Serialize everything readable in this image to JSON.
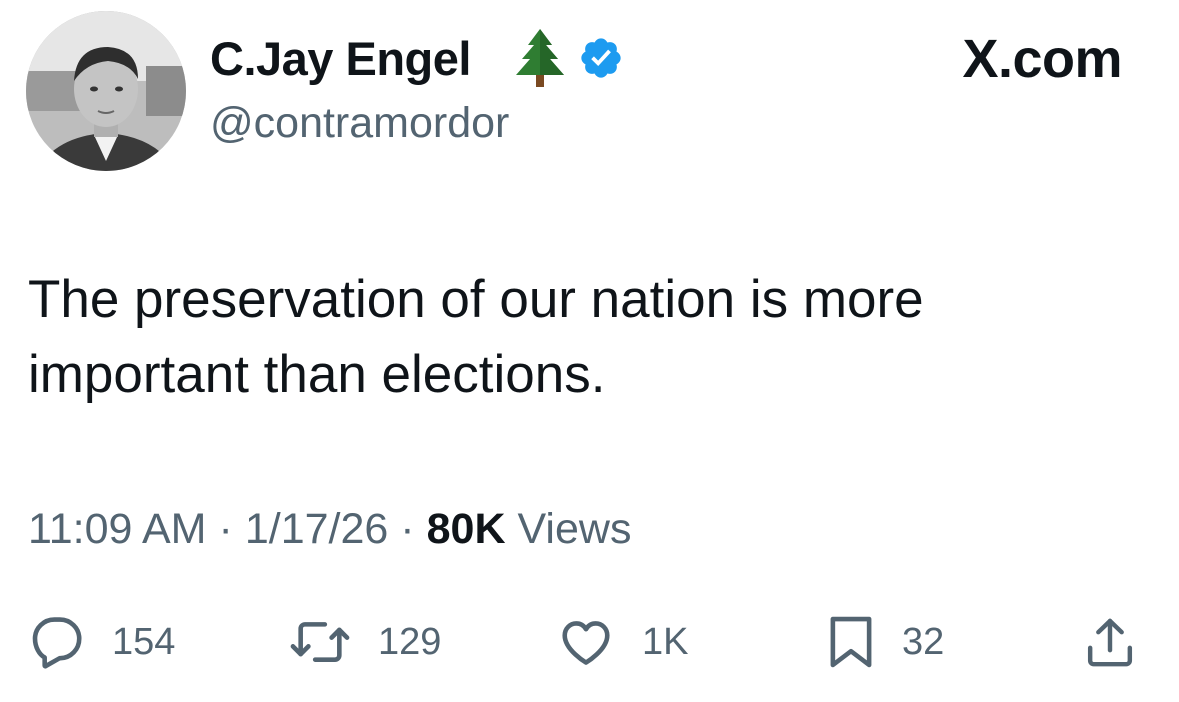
{
  "author": {
    "display_name": "C.Jay Engel",
    "name_emoji_icon": "evergreen-tree-icon",
    "verified_icon": "verified-badge-icon",
    "verified_color": "#1d9bf0",
    "handle": "@contramordor"
  },
  "brand": "X.com",
  "tweet": {
    "text": "The preservation of our nation is more important than elections."
  },
  "meta": {
    "time": "11:09 AM",
    "separator": "·",
    "date": "1/17/26",
    "views_count": "80K",
    "views_label": "Views"
  },
  "actions": {
    "replies": {
      "icon": "reply-icon",
      "count": "154"
    },
    "reposts": {
      "icon": "repost-icon",
      "count": "129"
    },
    "likes": {
      "icon": "heart-icon",
      "count": "1K"
    },
    "bookmarks": {
      "icon": "bookmark-icon",
      "count": "32"
    },
    "share": {
      "icon": "share-icon"
    }
  },
  "colors": {
    "text_primary": "#0f1419",
    "text_secondary": "#536471",
    "background": "#ffffff"
  }
}
